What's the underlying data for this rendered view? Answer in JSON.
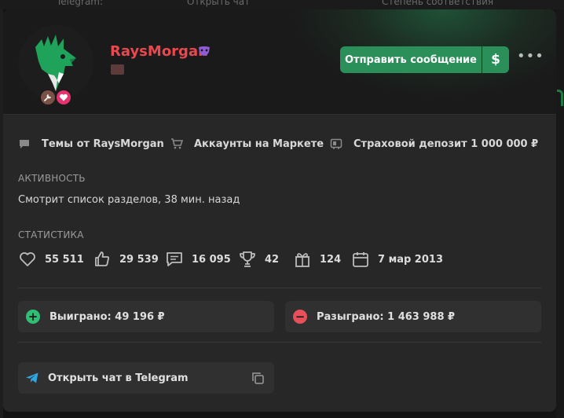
{
  "background": {
    "left_text": "Telegram:",
    "center_text": "Открыть чат",
    "right_text": "Степень соответствия"
  },
  "profile": {
    "username": "RaysMorgan",
    "username_color": "#e8484f",
    "accent_color": "#2a8f58"
  },
  "header_actions": {
    "message_label": "Отправить сообщение",
    "money_label": "$",
    "more_label": "•••"
  },
  "links": {
    "themes": "Темы от RaysMorgan",
    "market": "Аккаунты на Маркете",
    "deposit": "Страховой депозит 1 000 000 ₽"
  },
  "activity": {
    "title": "АКТИВНОСТЬ",
    "text": "Смотрит список разделов, 38 мин. назад"
  },
  "stats": {
    "title": "СТАТИСТИКА",
    "likes": "55 511",
    "thumbs": "29 539",
    "messages": "16 095",
    "trophies": "42",
    "gifts": "124",
    "registered": "7 мар 2013"
  },
  "results": {
    "won": "Выиграно: 49 196 ₽",
    "lost": "Разыграно: 1 463 988 ₽"
  },
  "telegram": {
    "label": "Открыть чат в Telegram"
  },
  "icons": [
    "chat-bubble-icon",
    "cart-icon",
    "deposit-icon",
    "heart-icon",
    "thumbs-up-icon",
    "message-icon",
    "trophy-icon",
    "gift-icon",
    "calendar-icon",
    "plus-icon",
    "minus-icon",
    "telegram-icon",
    "copy-icon",
    "mask-icon",
    "tools-icon"
  ]
}
